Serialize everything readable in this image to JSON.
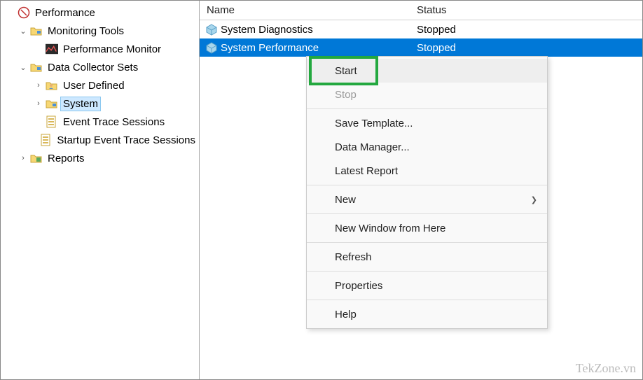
{
  "tree": {
    "root": {
      "label": "Performance"
    },
    "monitoring_tools": {
      "label": "Monitoring Tools"
    },
    "performance_monitor": {
      "label": "Performance Monitor"
    },
    "data_collector_sets": {
      "label": "Data Collector Sets"
    },
    "user_defined": {
      "label": "User Defined"
    },
    "system": {
      "label": "System"
    },
    "event_trace": {
      "label": "Event Trace Sessions"
    },
    "startup_event_trace": {
      "label": "Startup Event Trace Sessions"
    },
    "reports": {
      "label": "Reports"
    }
  },
  "list": {
    "headers": {
      "name": "Name",
      "status": "Status"
    },
    "rows": [
      {
        "name": "System Diagnostics",
        "status": "Stopped"
      },
      {
        "name": "System Performance",
        "status": "Stopped"
      }
    ]
  },
  "menu": {
    "start": "Start",
    "stop": "Stop",
    "save_template": "Save Template...",
    "data_manager": "Data Manager...",
    "latest_report": "Latest Report",
    "new": "New",
    "new_window": "New Window from Here",
    "refresh": "Refresh",
    "properties": "Properties",
    "help": "Help"
  },
  "watermark": "TekZone.vn"
}
